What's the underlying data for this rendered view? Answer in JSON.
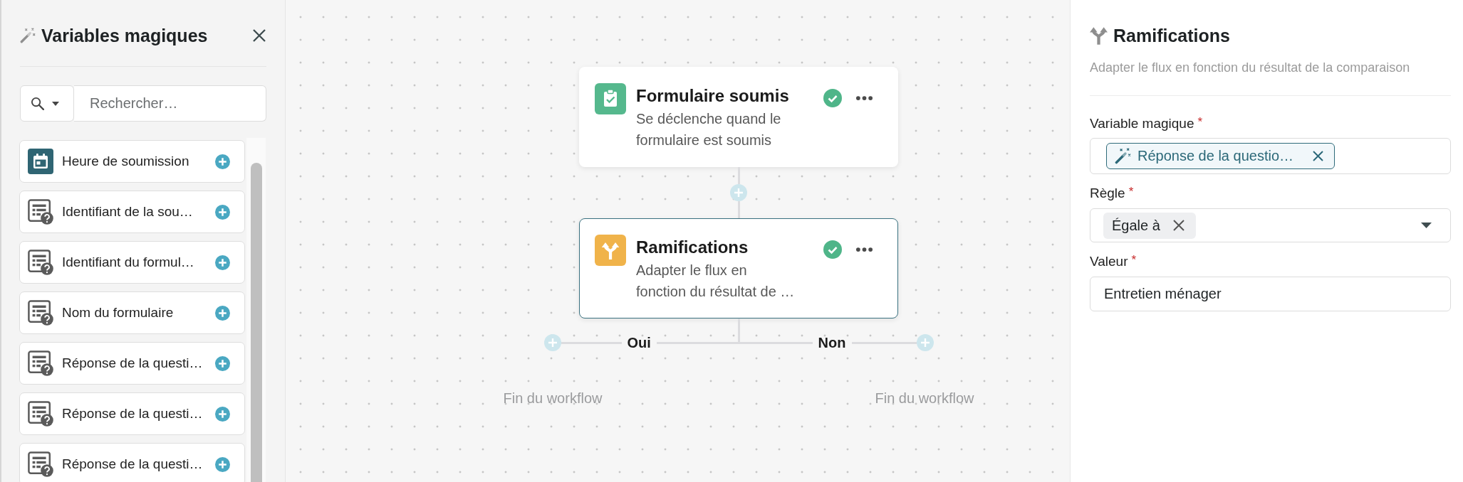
{
  "sidebar": {
    "title": "Variables magiques",
    "search": {
      "placeholder": "Rechercher…"
    },
    "items": [
      {
        "label": "Heure de soumission",
        "kind": "date"
      },
      {
        "label": "Identifiant de la sou…",
        "kind": "question"
      },
      {
        "label": "Identifiant du formul…",
        "kind": "question"
      },
      {
        "label": "Nom du formulaire",
        "kind": "question"
      },
      {
        "label": "Réponse de la questi…",
        "kind": "question"
      },
      {
        "label": "Réponse de la questi…",
        "kind": "question"
      },
      {
        "label": "Réponse de la questi…",
        "kind": "question"
      }
    ]
  },
  "canvas": {
    "nodes": [
      {
        "kind": "trigger",
        "title": "Formulaire soumis",
        "description_lines": [
          "Se déclenche quand le",
          "formulaire est soumis"
        ],
        "valid": true,
        "selected": false
      },
      {
        "kind": "branch",
        "title": "Ramifications",
        "description_lines": [
          "Adapter le flux en",
          "fonction du résultat de …"
        ],
        "valid": true,
        "selected": true
      }
    ],
    "branches": [
      {
        "label": "Oui",
        "end_label": "Fin du workflow"
      },
      {
        "label": "Non",
        "end_label": "Fin du workflow"
      }
    ]
  },
  "panel": {
    "title": "Ramifications",
    "subtitle": "Adapter le flux en fonction du résultat de la comparaison",
    "fields": [
      {
        "kind": "variable",
        "label": "Variable magique",
        "required_mark": "*",
        "chip": "Réponse de la questio…"
      },
      {
        "kind": "select",
        "label": "Règle",
        "required_mark": "*",
        "chip": "Égale à"
      },
      {
        "kind": "text",
        "label": "Valeur",
        "required_mark": "*",
        "value": "Entretien ménager"
      }
    ]
  }
}
